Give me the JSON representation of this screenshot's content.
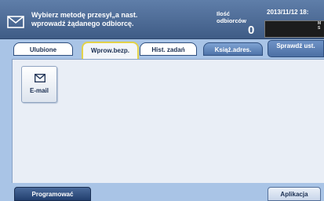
{
  "header": {
    "instruction_line1": "Wybierz metodę przesył„a nast.",
    "instruction_line2": "wprowadź żądanego odbiorcę.",
    "recipients_label_line1": "Ilość",
    "recipients_label_line2": "odbiorców",
    "recipients_count": "0",
    "datetime": "2013/11/12 18:",
    "side_letters": [
      "M",
      "S"
    ]
  },
  "tabs": [
    {
      "label": "Ulubione",
      "style": "white"
    },
    {
      "label": "Wprow.bezp.",
      "style": "active"
    },
    {
      "label": "Hist. zadań",
      "style": "white"
    },
    {
      "label": "Książ.adres.",
      "style": "blue"
    }
  ],
  "check_button": {
    "label": "Sprawdź ust."
  },
  "content": {
    "email_button": {
      "label": "E-mail",
      "icon": "envelope-icon"
    }
  },
  "footer": {
    "left_button": "Programować",
    "right_button": "Aplikacja"
  },
  "colors": {
    "header_bg": "#4a6a97",
    "page_bg": "#a9c4e6",
    "content_bg": "#e9eef6",
    "active_tab_border": "#e2d24a"
  }
}
